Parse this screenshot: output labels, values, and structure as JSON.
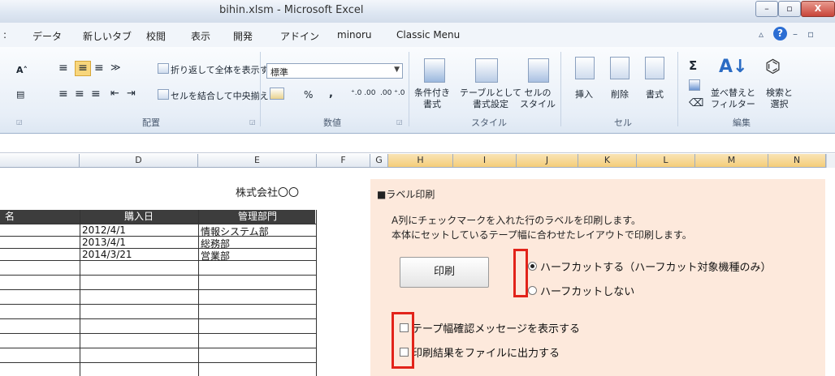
{
  "window": {
    "title": "bihin.xlsm  -  Microsoft Excel",
    "minimize_glyph": "–",
    "restore_glyph": "▫",
    "close_glyph": "X"
  },
  "tabs": [
    "データ",
    "新しいタブ",
    "校閲",
    "表示",
    "開発",
    "アドイン",
    "minoru",
    "Classic Menu"
  ],
  "tab_prefix": ":",
  "right_icons": {
    "caret": "▵",
    "help": "?",
    "min": "–",
    "restore": "▫"
  },
  "ribbon": {
    "wrap_text": "折り返して全体を表示する",
    "merge_center": "セルを結合して中央揃え",
    "number_format": "標準",
    "percent": "%",
    "comma": ",",
    "inc_decimal": "⁺.0 .00",
    "dec_decimal": ".00 ⁺.0",
    "conditional_format": "条件付き\n書式",
    "table_format": "テーブルとして\n書式設定",
    "cell_style": "セルの\nスタイル",
    "insert": "挿入",
    "delete": "削除",
    "format": "書式",
    "sort_filter": "並べ替えと\nフィルター",
    "find_select": "検索と\n選択",
    "sigma": "Σ",
    "groups": {
      "alignment": "配置",
      "number": "数値",
      "style": "スタイル",
      "cells": "セル",
      "edit": "編集"
    }
  },
  "columns": [
    "D",
    "E",
    "F",
    "G",
    "H",
    "I",
    "J",
    "K",
    "L",
    "M",
    "N"
  ],
  "sheet": {
    "company": "株式会社〇〇",
    "headers": [
      "名",
      "購入日",
      "管理部門"
    ],
    "rows": [
      [
        "2012/4/1",
        "情報システム部"
      ],
      [
        "2013/4/1",
        "総務部"
      ],
      [
        "2014/3/21",
        "営業部"
      ]
    ]
  },
  "label_panel": {
    "title": "■ラベル印刷",
    "desc1": "A列にチェックマークを入れた行のラベルを印刷します。",
    "desc2": "本体にセットしているテープ幅に合わせたレイアウトで印刷します。",
    "print_button": "印刷",
    "radio_half_cut": "ハーフカットする（ハーフカット対象機種のみ）",
    "radio_no_half_cut": "ハーフカットしない",
    "check_tape_msg": "テープ幅確認メッセージを表示する",
    "check_output_file": "印刷結果をファイルに出力する",
    "selected_radio": "half_cut",
    "tape_msg_checked": false,
    "output_file_checked": false
  },
  "colors": {
    "panel_bg": "#fde9dc",
    "highlight_red": "#e2231a",
    "header_dark": "#3d3d3d"
  }
}
